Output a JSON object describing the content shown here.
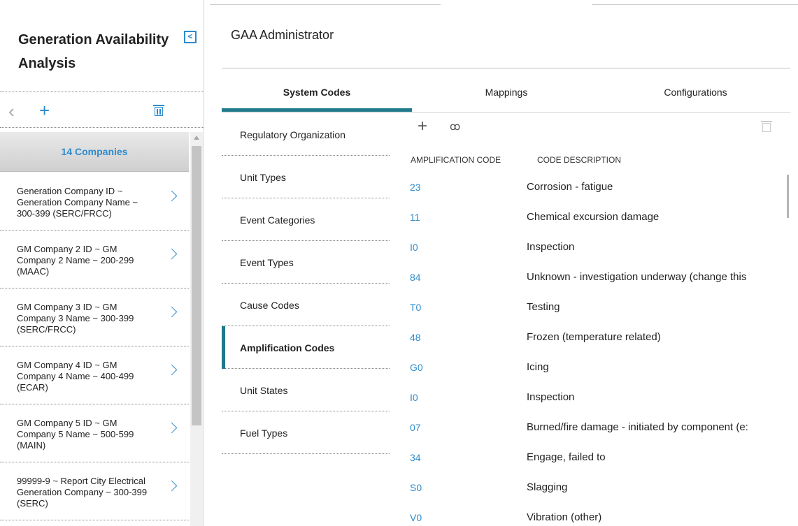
{
  "left_panel": {
    "title": "Generation Availability Analysis",
    "collapse_glyph": "<",
    "toolbar": {
      "back_glyph": "‹",
      "add_glyph": "+"
    },
    "companies_header": "14 Companies",
    "companies": [
      {
        "label": "Generation Company ID ~ Generation Company Name ~ 300-399 (SERC/FRCC)"
      },
      {
        "label": "GM Company 2 ID ~ GM Company 2 Name ~ 200-299 (MAAC)"
      },
      {
        "label": "GM Company 3 ID ~ GM Company 3 Name ~ 300-399 (SERC/FRCC)"
      },
      {
        "label": "GM Company 4 ID ~ GM Company 4 Name ~ 400-499 (ECAR)"
      },
      {
        "label": "GM Company 5 ID ~ GM Company 5 Name ~ 500-599 (MAIN)"
      },
      {
        "label": "99999-9 ~ Report City Electrical Generation Company ~ 300-399 (SERC)"
      }
    ]
  },
  "main": {
    "title": "GAA Administrator",
    "tabs": [
      {
        "label": "System Codes",
        "active": true
      },
      {
        "label": "Mappings",
        "active": false
      },
      {
        "label": "Configurations",
        "active": false
      }
    ],
    "subnav": [
      {
        "label": "Regulatory Organization"
      },
      {
        "label": "Unit Types"
      },
      {
        "label": "Event Categories"
      },
      {
        "label": "Event Types"
      },
      {
        "label": "Cause Codes"
      },
      {
        "label": "Amplification Codes",
        "active": true
      },
      {
        "label": "Unit States"
      },
      {
        "label": "Fuel Types"
      }
    ],
    "grid": {
      "toolbar": {
        "add_glyph": "+",
        "search_glyph": "ꝏ"
      },
      "columns": [
        "AMPLIFICATION CODE",
        "CODE DESCRIPTION"
      ],
      "rows": [
        {
          "code": "23",
          "description": "Corrosion - fatigue"
        },
        {
          "code": "11",
          "description": "Chemical excursion damage"
        },
        {
          "code": "I0",
          "description": "Inspection"
        },
        {
          "code": "84",
          "description": "Unknown - investigation underway (change this"
        },
        {
          "code": "T0",
          "description": "Testing"
        },
        {
          "code": "48",
          "description": "Frozen (temperature related)"
        },
        {
          "code": "G0",
          "description": "Icing"
        },
        {
          "code": "I0",
          "description": "Inspection"
        },
        {
          "code": "07",
          "description": "Burned/fire damage - initiated by component (e:"
        },
        {
          "code": "34",
          "description": "Engage, failed to"
        },
        {
          "code": "S0",
          "description": "Slagging"
        },
        {
          "code": "V0",
          "description": "Vibration (other)"
        }
      ]
    }
  },
  "colors": {
    "accent": "#2e8bcc",
    "tab_indicator": "#1f7a8c"
  },
  "icons": {
    "collapse": "chevron-left-icon",
    "back": "chevron-left-icon",
    "add": "plus-icon",
    "delete": "trash-icon",
    "search": "binoculars-icon",
    "row_open": "chevron-right-icon"
  }
}
